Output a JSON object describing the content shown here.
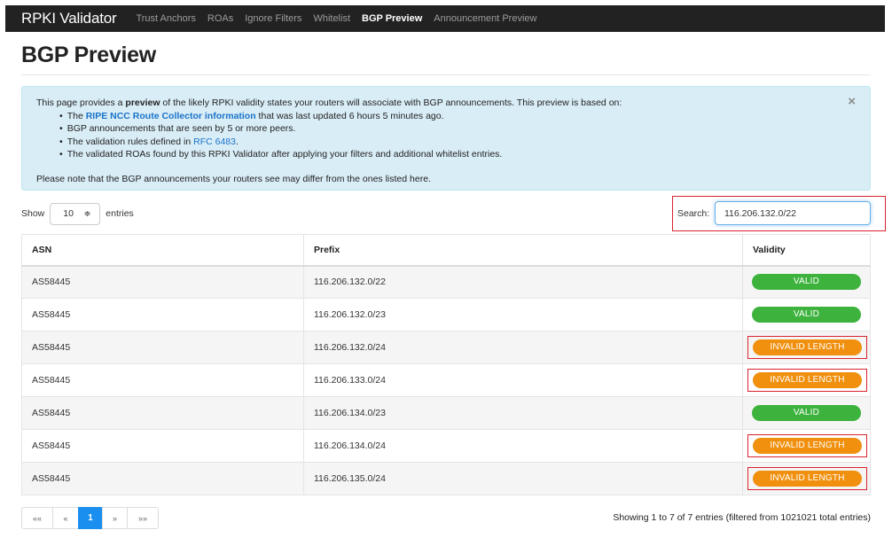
{
  "navbar": {
    "brand": "RPKI Validator",
    "items": [
      {
        "label": "Trust Anchors",
        "active": false
      },
      {
        "label": "ROAs",
        "active": false
      },
      {
        "label": "Ignore Filters",
        "active": false
      },
      {
        "label": "Whitelist",
        "active": false
      },
      {
        "label": "BGP Preview",
        "active": true
      },
      {
        "label": "Announcement Preview",
        "active": false
      }
    ]
  },
  "page_title": "BGP Preview",
  "info": {
    "intro_before": "This page provides a ",
    "intro_bold": "preview",
    "intro_after": " of the likely RPKI validity states your routers will associate with BGP announcements. This preview is based on:",
    "bullet1_link": "RIPE NCC Route Collector information",
    "bullet1_before": "The ",
    "bullet1_after": " that was last updated 6 hours 5 minutes ago.",
    "bullet2": "BGP announcements that are seen by 5 or more peers.",
    "bullet3_before": "The validation rules defined in ",
    "bullet3_link": "RFC 6483",
    "bullet3_after": ".",
    "bullet4": "The validated ROAs found by this RPKI Validator after applying your filters and additional whitelist entries.",
    "note": "Please note that the BGP announcements your routers see may differ from the ones listed here.",
    "close": "×"
  },
  "length": {
    "show": "Show",
    "value": "10",
    "caret": "≑",
    "entries": "entries"
  },
  "search": {
    "label": "Search:",
    "value": "116.206.132.0/22"
  },
  "table": {
    "headers": {
      "asn": "ASN",
      "prefix": "Prefix",
      "validity": "Validity"
    },
    "rows": [
      {
        "asn": "AS58445",
        "prefix": "116.206.132.0/22",
        "validity": "VALID",
        "status": "valid",
        "highlighted": false
      },
      {
        "asn": "AS58445",
        "prefix": "116.206.132.0/23",
        "validity": "VALID",
        "status": "valid",
        "highlighted": false
      },
      {
        "asn": "AS58445",
        "prefix": "116.206.132.0/24",
        "validity": "INVALID LENGTH",
        "status": "invalid",
        "highlighted": true
      },
      {
        "asn": "AS58445",
        "prefix": "116.206.133.0/24",
        "validity": "INVALID LENGTH",
        "status": "invalid",
        "highlighted": true
      },
      {
        "asn": "AS58445",
        "prefix": "116.206.134.0/23",
        "validity": "VALID",
        "status": "valid",
        "highlighted": false
      },
      {
        "asn": "AS58445",
        "prefix": "116.206.134.0/24",
        "validity": "INVALID LENGTH",
        "status": "invalid",
        "highlighted": true
      },
      {
        "asn": "AS58445",
        "prefix": "116.206.135.0/24",
        "validity": "INVALID LENGTH",
        "status": "invalid",
        "highlighted": true
      }
    ]
  },
  "pagination": {
    "first": "««",
    "prev": "«",
    "current": "1",
    "next": "»",
    "last": "»»"
  },
  "summary": "Showing 1 to 7 of 7 entries (filtered from 1021021 total entries)",
  "colors": {
    "valid": "#3db33d",
    "invalid": "#f0900e",
    "highlight_frame": "#d9232e",
    "info_bg": "#d9edf7",
    "active_page": "#1a8ff0"
  }
}
